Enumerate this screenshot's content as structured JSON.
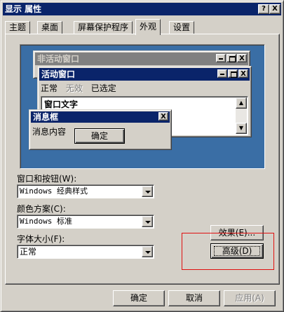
{
  "window": {
    "title": "显示 属性",
    "help_glyph": "?",
    "close_glyph": "X"
  },
  "tabs": [
    {
      "label": "主题",
      "active": false
    },
    {
      "label": "桌面",
      "active": false
    },
    {
      "label": "屏幕保护程序",
      "active": false
    },
    {
      "label": "外观",
      "active": true
    },
    {
      "label": "设置",
      "active": false
    }
  ],
  "preview": {
    "inactive_window_title": "非活动窗口",
    "active_window_title": "活动窗口",
    "menu": {
      "normal": "正常",
      "disabled": "无效",
      "selected": "已选定"
    },
    "window_text": "窗口文字",
    "message_box_title": "消息框",
    "message_text": "消息内容",
    "ok_label": "确定",
    "close_glyph": "X"
  },
  "fields": {
    "windows_buttons": {
      "label": "窗口和按钮(W):",
      "value": "Windows 经典样式"
    },
    "color_scheme": {
      "label": "颜色方案(C):",
      "value": "Windows 标准"
    },
    "font_size": {
      "label": "字体大小(F):",
      "value": "正常"
    }
  },
  "buttons": {
    "effects": "效果(E)...",
    "advanced": "高级(D)",
    "ok": "确定",
    "cancel": "取消",
    "apply": "应用(A)"
  },
  "colors": {
    "active_title": "#0a246a",
    "inactive_title": "#808080",
    "desktop": "#3a6ea5",
    "highlight_box": "#e01010"
  }
}
